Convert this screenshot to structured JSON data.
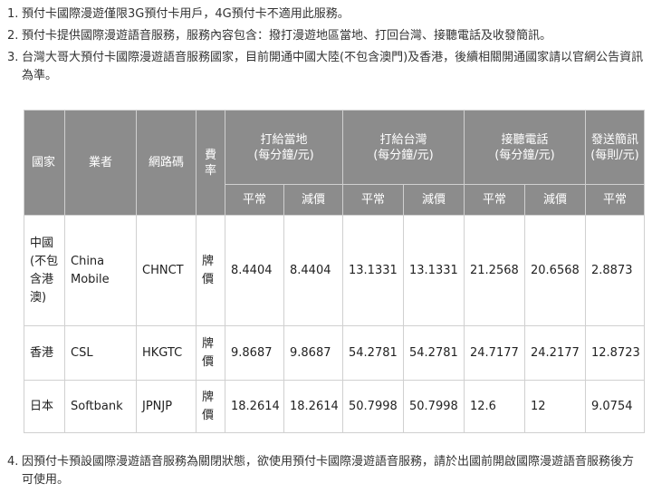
{
  "notes_top": [
    {
      "num": "1.",
      "text": "預付卡國際漫遊僅限3G預付卡用戶，4G預付卡不適用此服務。"
    },
    {
      "num": "2.",
      "text": "預付卡提供國際漫遊語音服務，服務內容包含：撥打漫遊地區當地、打回台灣、接聽電話及收發簡訊。"
    },
    {
      "num": "3.",
      "text": "台灣大哥大預付卡國際漫遊語音服務國家，目前開通中國大陸(不包含澳門)及香港，後續相關開通國家請以官網公告資訊為準。"
    }
  ],
  "table": {
    "headers": {
      "country": "國家",
      "operator": "業者",
      "network_code": "網路碼",
      "rate_type": "費率",
      "local": "打給當地\n(每分鐘/元)",
      "taiwan": "打給台灣\n(每分鐘/元)",
      "receive": "接聽電話\n(每分鐘/元)",
      "sms": "發送簡訊\n(每則/元)",
      "normal": "平常",
      "discount": "減價"
    },
    "rows": [
      {
        "country": "中國\n(不包含港澳)",
        "operator": "China Mobile",
        "code": "CHNCT",
        "rate": "牌價",
        "local_normal": "8.4404",
        "local_discount": "8.4404",
        "tw_normal": "13.1331",
        "tw_discount": "13.1331",
        "rcv_normal": "21.2568",
        "rcv_discount": "20.6568",
        "sms": "2.8873"
      },
      {
        "country": "香港",
        "operator": "CSL",
        "code": "HKGTC",
        "rate": "牌價",
        "local_normal": "9.8687",
        "local_discount": "9.8687",
        "tw_normal": "54.2781",
        "tw_discount": "54.2781",
        "rcv_normal": "24.7177",
        "rcv_discount": "24.2177",
        "sms": "12.8723"
      },
      {
        "country": "日本",
        "operator": "Softbank",
        "code": "JPNJP",
        "rate": "牌價",
        "local_normal": "18.2614",
        "local_discount": "18.2614",
        "tw_normal": "50.7998",
        "tw_discount": "50.7998",
        "rcv_normal": "12.6",
        "rcv_discount": "12",
        "sms": "9.0754"
      }
    ]
  },
  "notes_bottom": [
    {
      "num": "4.",
      "text": "因預付卡預設國際漫遊語音服務為關閉狀態，欲使用預付卡國際漫遊語音服務，請於出國前開啟國際漫遊語音服務後方可使用。"
    }
  ],
  "colors": {
    "header_bg": "#8c8c8c",
    "border": "#d0d0d0",
    "text": "#333333"
  }
}
